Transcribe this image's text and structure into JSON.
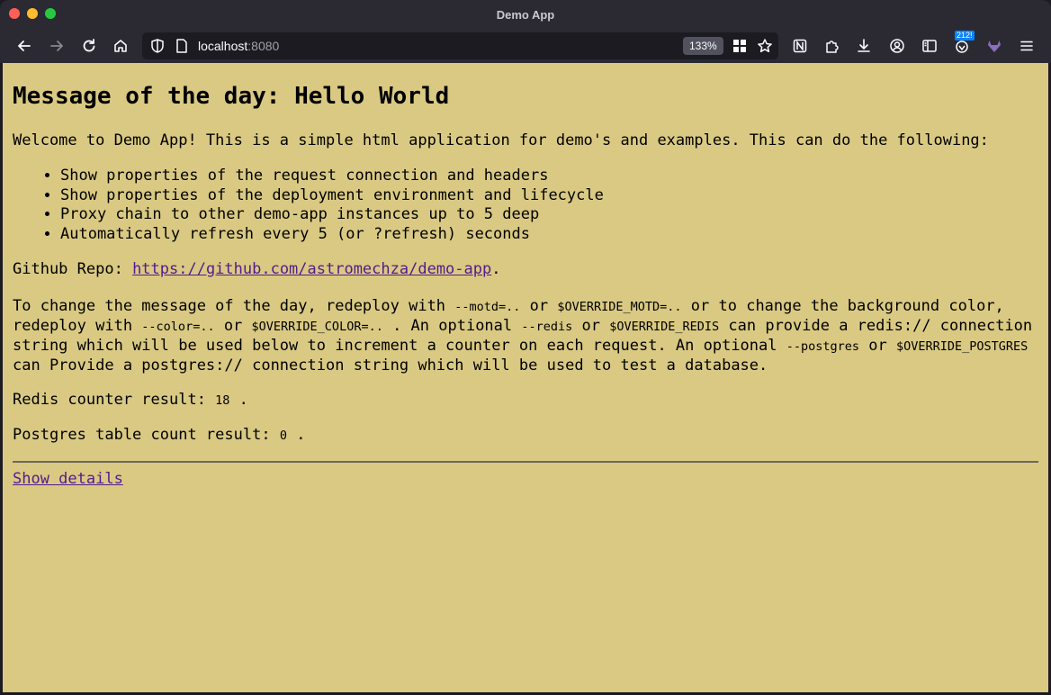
{
  "window": {
    "title": "Demo App"
  },
  "toolbar": {
    "url_host": "localhost",
    "url_port": ":8080",
    "zoom": "133%",
    "extension_badge": "212!"
  },
  "page": {
    "heading": "Message of the day: Hello World",
    "intro": "Welcome to Demo App! This is a simple html application for demo's and examples. This can do the following:",
    "features": [
      "Show properties of the request connection and headers",
      "Show properties of the deployment environment and lifecycle",
      "Proxy chain to other demo-app instances up to 5 deep",
      "Automatically refresh every 5 (or ?refresh) seconds"
    ],
    "repo_label": "Github Repo: ",
    "repo_link": "https://github.com/astromechza/demo-app",
    "repo_suffix": ".",
    "change": {
      "t1": "To change the message of the day, redeploy with ",
      "c1": "--motd=..",
      "t2": " or ",
      "c2": "$OVERRIDE_MOTD=..",
      "t3": " or to change the background color, redeploy with ",
      "c3": "--color=..",
      "t4": " or ",
      "c4": "$OVERRIDE_COLOR=..",
      "t5": " . An optional ",
      "c5": "--redis",
      "t6": " or ",
      "c6": "$OVERRIDE_REDIS",
      "t7": " can provide a redis:// connection string which will be used below to increment a counter on each request. An optional ",
      "c7": "--postgres",
      "t8": " or ",
      "c8": "$OVERRIDE_POSTGRES",
      "t9": " can Provide a postgres:// connection string which will be used to test a database."
    },
    "redis_label": "Redis counter result: ",
    "redis_value": "18",
    "redis_suffix": " .",
    "pg_label": "Postgres table count result: ",
    "pg_value": "0",
    "pg_suffix": " .",
    "details_link": "Show details"
  },
  "colors": {
    "page_background": "#d9c983",
    "link": "#551a8b"
  },
  "icons": [
    "back-icon",
    "forward-icon",
    "reload-icon",
    "home-icon",
    "shield-icon",
    "page-icon",
    "grid-icon",
    "star-icon",
    "notion-icon",
    "extensions-icon",
    "download-icon",
    "account-icon",
    "sidebar-icon",
    "shield-badge-icon",
    "gitlab-icon",
    "menu-icon"
  ]
}
